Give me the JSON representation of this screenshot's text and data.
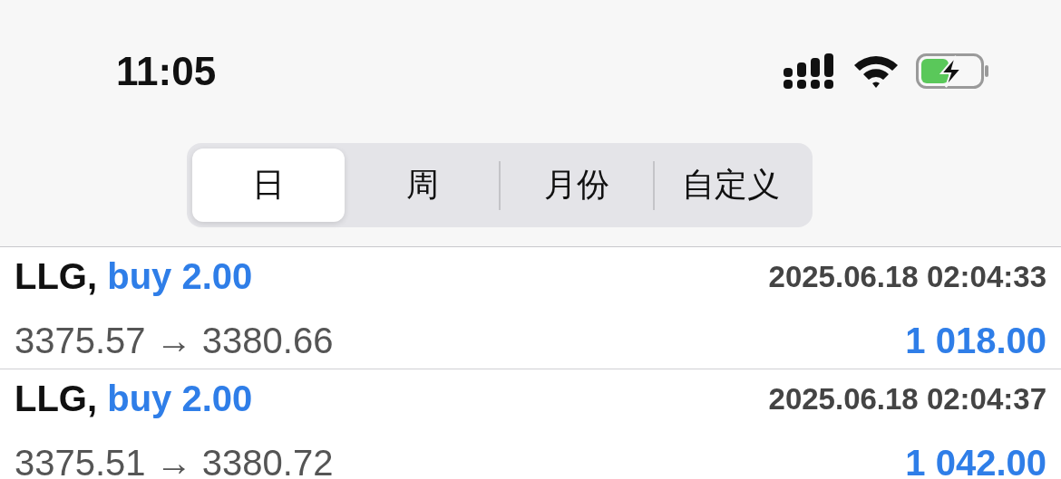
{
  "status_bar": {
    "time": "11:05"
  },
  "tabs": [
    {
      "label": "日",
      "selected": true
    },
    {
      "label": "周",
      "selected": false
    },
    {
      "label": "月份",
      "selected": false
    },
    {
      "label": "自定义",
      "selected": false
    }
  ],
  "trades": [
    {
      "symbol": "LLG,",
      "order": "buy 2.00",
      "time": "2025.06.18 02:04:33",
      "prices": "3375.57 → 3380.66",
      "profit": "1 018.00"
    },
    {
      "symbol": "LLG,",
      "order": "buy 2.00",
      "time": "2025.06.18 02:04:37",
      "prices": "3375.51 → 3380.72",
      "profit": "1 042.00"
    }
  ]
}
